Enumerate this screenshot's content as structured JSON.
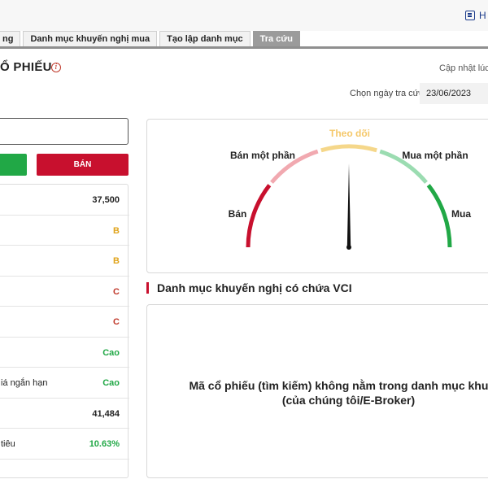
{
  "header": {
    "help_label": "H"
  },
  "tabs": [
    {
      "label": "ng"
    },
    {
      "label": "Danh mục khuyến nghị mua"
    },
    {
      "label": "Tạo lập danh mục"
    },
    {
      "label": "Tra cứu"
    }
  ],
  "page": {
    "title": "Ổ PHIẾU",
    "info_icon": "i",
    "update_label": "Cập nhật lúc:",
    "date_label": "Chọn ngày tra cứu",
    "date_value": "23/06/2023"
  },
  "search": {
    "value": ""
  },
  "actions": {
    "buy_label": "",
    "sell_label": "BÁN"
  },
  "metrics": [
    {
      "label": "",
      "value": "37,500",
      "color": "#222222"
    },
    {
      "label": "",
      "value": "B",
      "color": "#e0a31a"
    },
    {
      "label": "",
      "value": "B",
      "color": "#e0a31a"
    },
    {
      "label": "",
      "value": "C",
      "color": "#c0392b"
    },
    {
      "label": "",
      "value": "C",
      "color": "#c0392b"
    },
    {
      "label": "",
      "value": "Cao",
      "color": "#21a846"
    },
    {
      "label": "iá ngắn hạn",
      "value": "Cao",
      "color": "#21a846"
    },
    {
      "label": "",
      "value": "41,484",
      "color": "#222222"
    },
    {
      "label": "tiêu",
      "value": "10.63%",
      "color": "#21a846"
    }
  ],
  "gauge": {
    "labels": {
      "sell": "Bán",
      "partial_sell": "Bán một phần",
      "watch": "Theo dõi",
      "partial_buy": "Mua một phần",
      "buy": "Mua"
    },
    "colors": {
      "sell": "#c8102e",
      "partial_sell": "#f1a9b0",
      "watch": "#f5d78a",
      "partial_buy": "#9bdcb1",
      "buy": "#21a846"
    },
    "needle_fraction": 0.5
  },
  "section": {
    "title": "Danh mục khuyến nghị có chứa VCI",
    "notice_line1": "Mã cổ phiếu (tìm kiếm) không nằm trong danh mục khuyến",
    "notice_line2": "(của chúng tôi/E-Broker)"
  }
}
